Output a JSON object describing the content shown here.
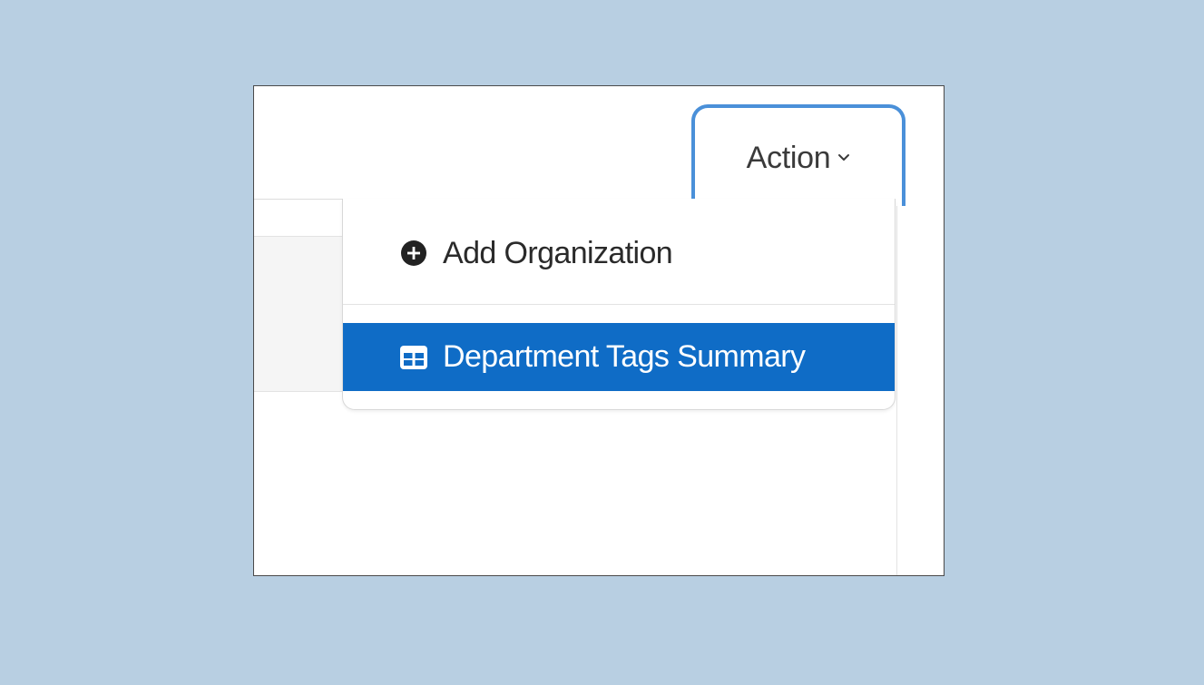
{
  "action_button": {
    "label": "Action",
    "focus_color": "#4a90d9"
  },
  "dropdown": {
    "items": [
      {
        "label": "Add Organization",
        "icon": "plus-circle-icon",
        "highlighted": false
      },
      {
        "label": "Department Tags Summary",
        "icon": "table-icon",
        "highlighted": true
      }
    ],
    "highlight_color": "#0f6cc6"
  }
}
